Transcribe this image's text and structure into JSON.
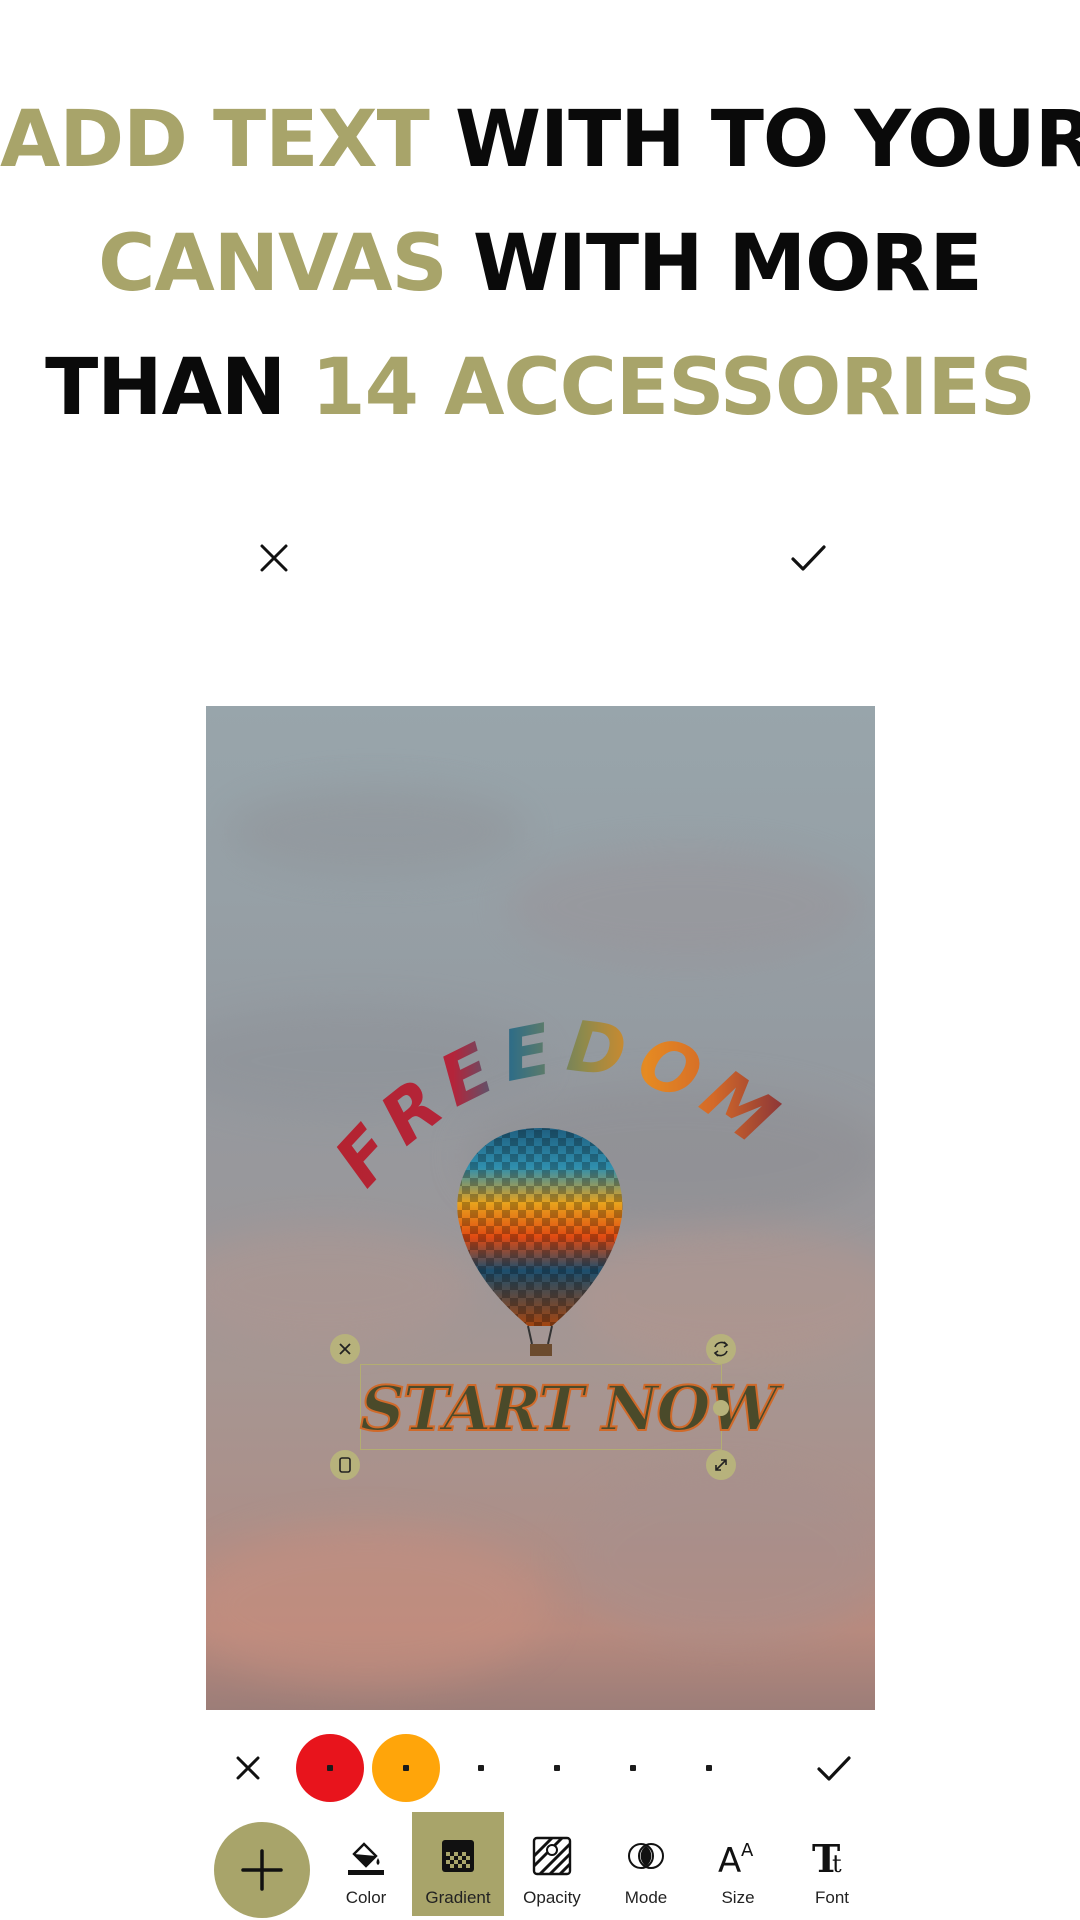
{
  "promo": {
    "line1_a": "ADD TEXT",
    "line1_b": " WITH TO YOUR",
    "line2_a": "CANVAS",
    "line2_b": " WITH MORE",
    "line3_a": "THAN ",
    "line3_b": "14 ACCESSORIES"
  },
  "canvas": {
    "curved_text": "FREEDOM",
    "selected_text": "START NOW"
  },
  "gradient_colors": [
    "#e8141c",
    "#ffa50a"
  ],
  "accent_color": "#a8a46a",
  "toolbar": {
    "items": [
      {
        "label": "Color",
        "icon": "paint-bucket-icon"
      },
      {
        "label": "Gradient",
        "icon": "gradient-icon"
      },
      {
        "label": "Opacity",
        "icon": "opacity-icon"
      },
      {
        "label": "Mode",
        "icon": "blend-mode-icon"
      },
      {
        "label": "Size",
        "icon": "font-size-icon"
      },
      {
        "label": "Font",
        "icon": "font-icon"
      }
    ],
    "active": "Gradient"
  }
}
